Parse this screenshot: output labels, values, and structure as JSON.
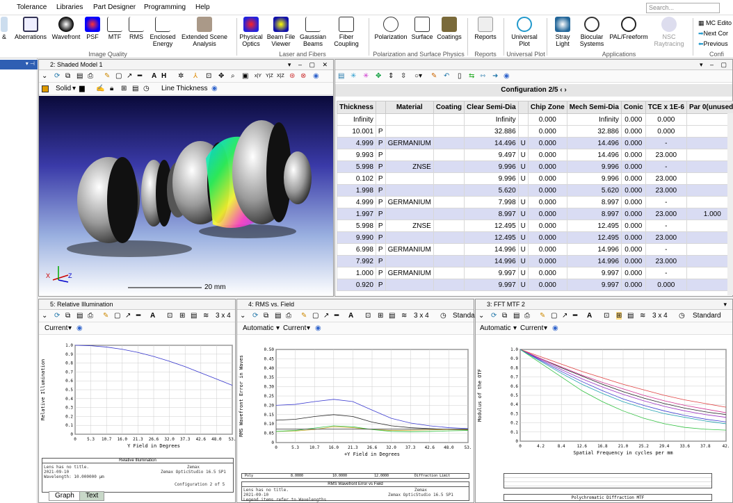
{
  "menu": {
    "items": [
      "Tolerance",
      "Libraries",
      "Part Designer",
      "Programming",
      "Help"
    ],
    "search_placeholder": "Search..."
  },
  "ribbon": {
    "buttons": [
      {
        "label": "&",
        "sub": ""
      },
      {
        "label": "Aberrations",
        "sub": ""
      },
      {
        "label": "Wavefront",
        "sub": ""
      },
      {
        "label": "PSF",
        "sub": ""
      },
      {
        "label": "MTF",
        "sub": ""
      },
      {
        "label": "RMS",
        "sub": ""
      },
      {
        "label": "Enclosed",
        "sub": "Energy"
      },
      {
        "label": "Extended Scene",
        "sub": "Analysis"
      },
      {
        "label": "Physical",
        "sub": "Optics"
      },
      {
        "label": "Beam File",
        "sub": "Viewer"
      },
      {
        "label": "Gaussian",
        "sub": "Beams"
      },
      {
        "label": "Fiber",
        "sub": "Coupling"
      },
      {
        "label": "Polarization",
        "sub": ""
      },
      {
        "label": "Surface",
        "sub": ""
      },
      {
        "label": "Coatings",
        "sub": ""
      },
      {
        "label": "Reports",
        "sub": ""
      },
      {
        "label": "Universal",
        "sub": "Plot"
      },
      {
        "label": "Stray",
        "sub": "Light"
      },
      {
        "label": "Biocular",
        "sub": "Systems"
      },
      {
        "label": "PAL/Freeform",
        "sub": ""
      },
      {
        "label": "NSC",
        "sub": "Raytracing"
      }
    ],
    "mc": {
      "editor": "MC Edito",
      "next": "Next Cor",
      "previous": "Previous"
    },
    "groups": [
      "Image Quality",
      "Laser and Fibers",
      "Polarization and Surface Physics",
      "Reports",
      "Universal Plot",
      "Applications",
      "Confi"
    ]
  },
  "shaded": {
    "title": "2: Shaded Model 1",
    "solid": "Solid",
    "line_thickness": "Line Thickness",
    "scale": "20 mm",
    "axis_x": "X",
    "axis_z": "Z"
  },
  "lde": {
    "config": "Configuration 2/5",
    "columns": [
      "Thickness",
      "",
      "Material",
      "Coating",
      "Clear Semi-Dia",
      "",
      "Chip Zone",
      "Mech Semi-Dia",
      "Conic",
      "TCE x 1E-6",
      "Par 0(unused)"
    ],
    "rows": [
      [
        "Infinity",
        "",
        "",
        "",
        "Infinity",
        "",
        "0.000",
        "Infinity",
        "0.000",
        "0.000",
        ""
      ],
      [
        "10.001",
        "P",
        "",
        "",
        "32.886",
        "",
        "0.000",
        "32.886",
        "0.000",
        "0.000",
        ""
      ],
      [
        "4.999",
        "P",
        "GERMANIUM",
        "",
        "14.496",
        "U",
        "0.000",
        "14.496",
        "0.000",
        "-",
        ""
      ],
      [
        "9.993",
        "P",
        "",
        "",
        "9.497",
        "U",
        "0.000",
        "14.496",
        "0.000",
        "23.000",
        ""
      ],
      [
        "5.998",
        "P",
        "ZNSE",
        "",
        "9.996",
        "U",
        "0.000",
        "9.996",
        "0.000",
        "-",
        ""
      ],
      [
        "0.102",
        "P",
        "",
        "",
        "9.996",
        "U",
        "0.000",
        "9.996",
        "0.000",
        "23.000",
        ""
      ],
      [
        "1.998",
        "P",
        "",
        "",
        "5.620",
        "",
        "0.000",
        "5.620",
        "0.000",
        "23.000",
        ""
      ],
      [
        "4.999",
        "P",
        "GERMANIUM",
        "",
        "7.998",
        "U",
        "0.000",
        "8.997",
        "0.000",
        "-",
        ""
      ],
      [
        "1.997",
        "P",
        "",
        "",
        "8.997",
        "U",
        "0.000",
        "8.997",
        "0.000",
        "23.000",
        "1.000"
      ],
      [
        "5.998",
        "P",
        "ZNSE",
        "",
        "12.495",
        "U",
        "0.000",
        "12.495",
        "0.000",
        "-",
        ""
      ],
      [
        "9.990",
        "P",
        "",
        "",
        "12.495",
        "U",
        "0.000",
        "12.495",
        "0.000",
        "23.000",
        ""
      ],
      [
        "6.998",
        "P",
        "GERMANIUM",
        "",
        "14.996",
        "U",
        "0.000",
        "14.996",
        "0.000",
        "-",
        ""
      ],
      [
        "7.992",
        "P",
        "",
        "",
        "14.996",
        "U",
        "0.000",
        "14.996",
        "0.000",
        "23.000",
        ""
      ],
      [
        "1.000",
        "P",
        "GERMANIUM",
        "",
        "9.997",
        "U",
        "0.000",
        "9.997",
        "0.000",
        "-",
        ""
      ],
      [
        "0.920",
        "P",
        "",
        "",
        "9.997",
        "U",
        "0.000",
        "9.997",
        "0.000",
        "0.000",
        ""
      ]
    ]
  },
  "ri": {
    "title": "5: Relative Illumination",
    "current": "Current",
    "grid": "3 x 4",
    "plot_title": "Relative Illumination",
    "foot1": "Lens has no title.",
    "foot2": "2021-09-10",
    "foot3": "Wavelength: 10.000000 µm",
    "foot4": "Zemax",
    "foot5": "Zemax OpticStudio 16.5 SP1",
    "foot6": "Configuration 2 of 5"
  },
  "rms": {
    "title": "4: RMS vs. Field",
    "automatic": "Automatic",
    "current": "Current",
    "grid": "3 x 4",
    "standard": "Standa",
    "plot_title": "RMS Wavefront Error vs Field",
    "foot1": "Lens has no title.",
    "foot2": "2021-09-10",
    "foot3": "Legend items refer to Wavelengths",
    "foot4": "Zemax",
    "foot5": "Zemax OpticStudio 16.5 SP1",
    "legend": [
      "Poly",
      "8.0000",
      "10.0000",
      "12.0000",
      "Diffraction Limit"
    ]
  },
  "mtf": {
    "title": "3: FFT MTF 2",
    "automatic": "Automatic",
    "current": "Current",
    "grid": "3 x 4",
    "standard": "Standard",
    "plot_title": "Polychromatic Diffraction MTF"
  },
  "tabs": {
    "graph": "Graph",
    "text": "Text"
  },
  "colors": {
    "nav": "#2f5fb3",
    "row_alt": "#d9dcf3",
    "ri_curve": "#3333cc"
  },
  "chart_data": [
    {
      "type": "line",
      "title": "Relative Illumination",
      "xlabel": "Y Field in Degrees",
      "ylabel": "Relative Illumination",
      "x": [
        0,
        5.3,
        10.7,
        16.0,
        21.3,
        26.6,
        32.0,
        37.3,
        42.6,
        48.0,
        53.3
      ],
      "xticks": [
        "0",
        "5.3",
        "10.7",
        "16.0",
        "21.3",
        "26.6",
        "32.0",
        "37.3",
        "42.6",
        "48.0",
        "53."
      ],
      "yticks": [
        "0",
        "0.1",
        "0.2",
        "0.3",
        "0.4",
        "0.5",
        "0.6",
        "0.7",
        "0.8",
        "0.9",
        "1.0"
      ],
      "ylim": [
        0,
        1.0
      ],
      "series": [
        {
          "values": [
            1.0,
            0.995,
            0.98,
            0.955,
            0.92,
            0.875,
            0.82,
            0.76,
            0.69,
            0.62,
            0.55
          ]
        }
      ]
    },
    {
      "type": "line",
      "title": "RMS Wavefront Error vs Field",
      "xlabel": "+Y Field in Degrees",
      "ylabel": "RMS Wavefront Error in Waves",
      "x": [
        0,
        5.3,
        10.7,
        16.0,
        21.3,
        26.6,
        32.0,
        37.3,
        42.6,
        48.0,
        53.3
      ],
      "xticks": [
        "0",
        "5.3",
        "10.7",
        "16.0",
        "21.3",
        "26.6",
        "32.0",
        "37.3",
        "42.6",
        "48.0",
        "53."
      ],
      "yticks": [
        "0",
        "0.05",
        "0.10",
        "0.15",
        "0.20",
        "0.25",
        "0.30",
        "0.35",
        "0.40",
        "0.45",
        "0.50"
      ],
      "ylim": [
        0,
        0.5
      ],
      "series": [
        {
          "name": "8.0000",
          "color": "#3a3ad0",
          "values": [
            0.2,
            0.205,
            0.22,
            0.232,
            0.22,
            0.175,
            0.13,
            0.105,
            0.09,
            0.08,
            0.075
          ]
        },
        {
          "name": "Poly",
          "color": "#222222",
          "values": [
            0.12,
            0.125,
            0.14,
            0.15,
            0.14,
            0.11,
            0.09,
            0.08,
            0.075,
            0.07,
            0.068
          ]
        },
        {
          "name": "10.0000",
          "color": "#c0a020",
          "values": [
            0.06,
            0.062,
            0.07,
            0.085,
            0.08,
            0.07,
            0.065,
            0.066,
            0.068,
            0.07,
            0.07
          ]
        },
        {
          "name": "12.0000",
          "color": "#30c040",
          "values": [
            0.06,
            0.065,
            0.078,
            0.09,
            0.085,
            0.07,
            0.06,
            0.058,
            0.06,
            0.063,
            0.065
          ]
        },
        {
          "name": "Diffraction Limit",
          "color": "#444444",
          "values": [
            0.072,
            0.072,
            0.072,
            0.072,
            0.072,
            0.072,
            0.072,
            0.072,
            0.072,
            0.072,
            0.072
          ]
        }
      ]
    },
    {
      "type": "line",
      "title": "Polychromatic Diffraction MTF",
      "xlabel": "Spatial Frequency in cycles per mm",
      "ylabel": "Modulus of the OTF",
      "x": [
        0,
        4.2,
        8.4,
        12.6,
        16.8,
        21.0,
        25.2,
        29.4,
        33.6,
        37.8,
        42.0
      ],
      "xticks": [
        "0",
        "4.2",
        "8.4",
        "12.6",
        "16.8",
        "21.0",
        "25.2",
        "29.4",
        "33.6",
        "37.8",
        "42."
      ],
      "yticks": [
        "0",
        "0.1",
        "0.2",
        "0.3",
        "0.4",
        "0.5",
        "0.6",
        "0.7",
        "0.8",
        "0.9",
        "1.0"
      ],
      "ylim": [
        0,
        1.0
      ],
      "series": [
        {
          "color": "#222222",
          "values": [
            1.0,
            0.9,
            0.8,
            0.71,
            0.62,
            0.54,
            0.47,
            0.41,
            0.36,
            0.32,
            0.29
          ]
        },
        {
          "color": "#3a3ad0",
          "values": [
            1.0,
            0.88,
            0.76,
            0.65,
            0.55,
            0.46,
            0.39,
            0.33,
            0.28,
            0.24,
            0.21
          ]
        },
        {
          "color": "#30c040",
          "values": [
            1.0,
            0.85,
            0.7,
            0.55,
            0.43,
            0.33,
            0.25,
            0.19,
            0.15,
            0.13,
            0.12
          ]
        },
        {
          "color": "#d03090",
          "values": [
            1.0,
            0.9,
            0.81,
            0.72,
            0.64,
            0.57,
            0.5,
            0.44,
            0.39,
            0.35,
            0.31
          ]
        },
        {
          "color": "#9a30c0",
          "values": [
            1.0,
            0.89,
            0.78,
            0.68,
            0.59,
            0.51,
            0.44,
            0.38,
            0.33,
            0.29,
            0.26
          ]
        },
        {
          "color": "#e04040",
          "values": [
            1.0,
            0.92,
            0.84,
            0.76,
            0.69,
            0.62,
            0.56,
            0.5,
            0.45,
            0.41,
            0.37
          ]
        },
        {
          "color": "#20a0b0",
          "values": [
            1.0,
            0.87,
            0.74,
            0.62,
            0.52,
            0.43,
            0.36,
            0.3,
            0.26,
            0.22,
            0.19
          ]
        }
      ]
    }
  ]
}
